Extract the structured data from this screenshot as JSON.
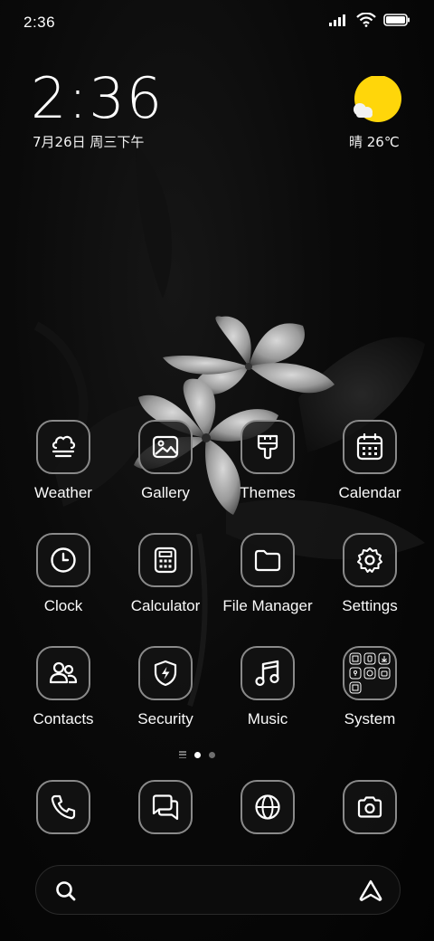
{
  "status_bar": {
    "time": "2:36",
    "icons": [
      "signal-icon",
      "wifi-icon",
      "battery-icon"
    ]
  },
  "clock_widget": {
    "time": "2:36",
    "date": "7月26日 周三下午"
  },
  "weather_widget": {
    "icon": "sun-cloud-icon",
    "text": "晴 26℃",
    "sun_color": "#FFD60A"
  },
  "apps": [
    {
      "label": "Weather",
      "icon": "weather-fog-icon"
    },
    {
      "label": "Gallery",
      "icon": "gallery-icon"
    },
    {
      "label": "Themes",
      "icon": "paintbrush-icon"
    },
    {
      "label": "Calendar",
      "icon": "calendar-icon"
    },
    {
      "label": "Clock",
      "icon": "clock-icon"
    },
    {
      "label": "Calculator",
      "icon": "calculator-icon"
    },
    {
      "label": "File Manager",
      "icon": "folder-icon"
    },
    {
      "label": "Settings",
      "icon": "gear-icon"
    },
    {
      "label": "Contacts",
      "icon": "contacts-icon"
    },
    {
      "label": "Security",
      "icon": "shield-icon"
    },
    {
      "label": "Music",
      "icon": "music-note-icon"
    },
    {
      "label": "System",
      "icon": "folder-grid-icon"
    }
  ],
  "page_indicator": {
    "pages": 2,
    "current": 1
  },
  "dock": [
    {
      "icon": "phone-icon"
    },
    {
      "icon": "messages-icon"
    },
    {
      "icon": "globe-icon"
    },
    {
      "icon": "camera-icon"
    }
  ],
  "search_bar": {
    "left_icon": "search-icon",
    "right_icon": "assistant-icon"
  },
  "colors": {
    "icon_border": "#8A8A8A",
    "background": "#050505",
    "sun": "#FFD60A"
  }
}
